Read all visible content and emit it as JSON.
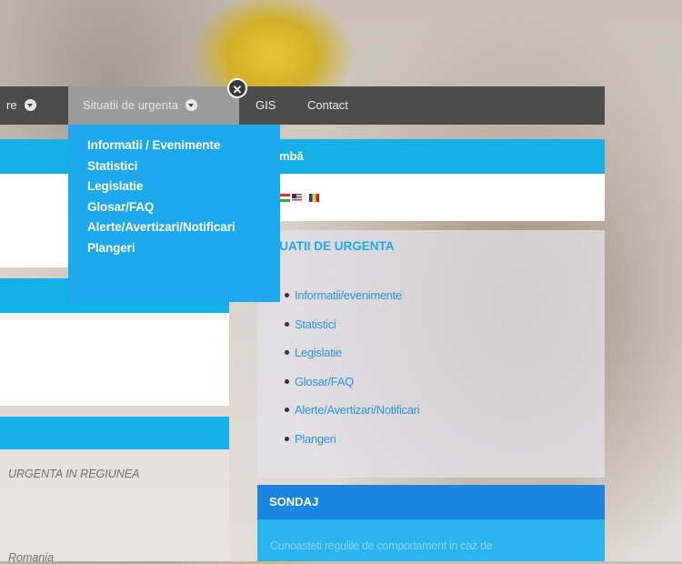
{
  "nav": {
    "prev_item_label": "re",
    "active_item_label": "Situatii de urgenta",
    "items": [
      {
        "label": "GIS"
      },
      {
        "label": "Contact"
      }
    ]
  },
  "dropdown": {
    "items": [
      {
        "label": "Informatii / Evenimente"
      },
      {
        "label": "Statistici"
      },
      {
        "label": "Legislatie"
      },
      {
        "label": "Glosar/FAQ"
      },
      {
        "label": "Alerte/Avertizari/Notificari"
      },
      {
        "label": "Plangeri"
      }
    ]
  },
  "language": {
    "heading": "mbă",
    "flags": [
      "hungary",
      "usa",
      "romania"
    ]
  },
  "situatii": {
    "title": "TUATII DE URGENTA",
    "links": [
      {
        "label": "Informatii/evenimente"
      },
      {
        "label": "Statistici"
      },
      {
        "label": "Legislatie"
      },
      {
        "label": "Glosar/FAQ"
      },
      {
        "label": "Alerte/Avertizari/Notificari"
      },
      {
        "label": "Plangeri"
      }
    ]
  },
  "sondaj": {
    "heading": "SONDAJ",
    "question": "Cunoasteti regulile de comportament in caz de"
  },
  "left": {
    "text_region": "URGENTA IN REGIUNEA",
    "text_country": "Romania"
  },
  "colors": {
    "accent_blue": "#1ea8ee",
    "nav_dark": "#4c4c4c",
    "nav_active": "#9b9b9b",
    "sondaj_blue": "#1a86df"
  }
}
